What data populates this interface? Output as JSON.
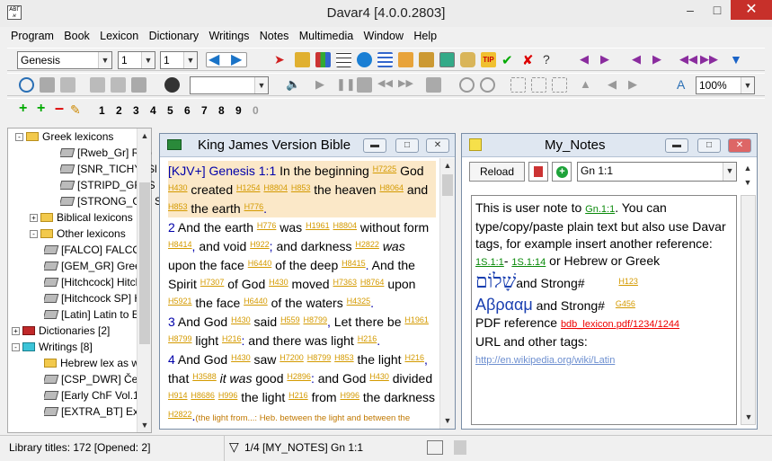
{
  "window": {
    "title": "Davar4 [4.0.0.2803]",
    "app_icon": "ΑΒΓ א"
  },
  "menu": [
    "Program",
    "Book",
    "Lexicon",
    "Dictionary",
    "Writings",
    "Notes",
    "Multimedia",
    "Window",
    "Help"
  ],
  "toolbar": {
    "book": "Genesis",
    "chapter": "1",
    "verse": "1",
    "zoom": "100%",
    "numbers": [
      "1",
      "2",
      "3",
      "4",
      "5",
      "6",
      "7",
      "8",
      "9",
      "0"
    ]
  },
  "sidebar": {
    "items": [
      {
        "label": "Greek lexicons",
        "type": "folder",
        "expanded": true
      },
      {
        "label": "[Rweb_Gr] Rob",
        "type": "book"
      },
      {
        "label": "[SNR_TICHY] Sl",
        "type": "book"
      },
      {
        "label": "[STRIPD_GR] S",
        "type": "book"
      },
      {
        "label": "[STRONG_GR] St",
        "type": "book"
      },
      {
        "label": "Biblical lexicons",
        "type": "folder"
      },
      {
        "label": "Other lexicons",
        "type": "folder"
      },
      {
        "label": "[FALCO] FALCO",
        "type": "book"
      },
      {
        "label": "[GEM_GR] Greek",
        "type": "book"
      },
      {
        "label": "[Hitchcock] Hitch",
        "type": "book"
      },
      {
        "label": "[Hitchcock SP] Hi",
        "type": "book"
      },
      {
        "label": "[Latin] Latin to E",
        "type": "book"
      },
      {
        "label": "Dictionaries [2]",
        "type": "root-red"
      },
      {
        "label": "Writings [8]",
        "type": "root-cyan"
      },
      {
        "label": "Hebrew lex as wi",
        "type": "folder"
      },
      {
        "label": "[CSP_DWR] Česk",
        "type": "book"
      },
      {
        "label": "[Early ChF Vol.1",
        "type": "book"
      },
      {
        "label": "[EXTRA_BT] Extr",
        "type": "book"
      }
    ]
  },
  "bible": {
    "title": "King James Version Bible"
  },
  "notes": {
    "title": "My_Notes",
    "reload": "Reload",
    "ref": "Gn 1:1",
    "p1a": "This is user note to ",
    "p1ref": "Gn.1:1",
    "p1b": ". You can type/copy/paste plain text but also use Davar tags, for example insert another reference:",
    "r1": "1S.1:1",
    "dash": "- ",
    "r2": "1S.1:14",
    "p2": " or Hebrew or Greek",
    "heb": "שָׁלוֹם",
    "and_strong1": "and Strong# ",
    "s1": "H123",
    "grk": "Αβρααμ",
    "and_strong2": " and Strong# ",
    "s2": "G456",
    "pdf_label": "PDF reference  ",
    "pdf": "bdb_lexicon.pdf/1234/1244",
    "url_label": "URL and other tags:",
    "url": "http://en.wikipedia.org/wiki/Latin"
  },
  "status": {
    "left": "Library titles: 172  [Opened: 2]",
    "mid": "1/4 [MY_NOTES] Gn 1:1"
  }
}
